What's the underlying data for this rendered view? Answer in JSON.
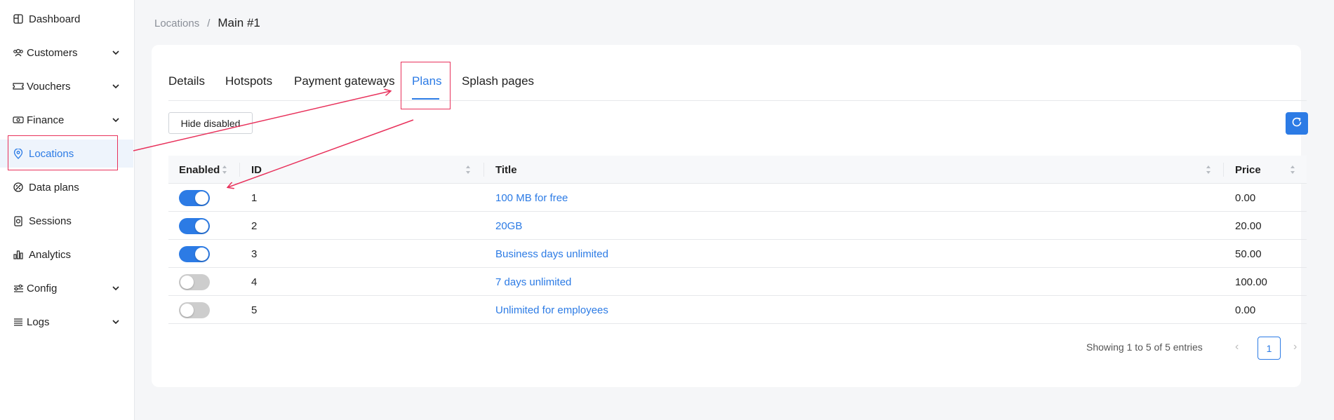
{
  "sidebar": {
    "items": [
      {
        "label": "Dashboard",
        "icon": "dashboard-icon"
      },
      {
        "label": "Customers",
        "icon": "customers-icon",
        "expandable": true
      },
      {
        "label": "Vouchers",
        "icon": "vouchers-icon",
        "expandable": true
      },
      {
        "label": "Finance",
        "icon": "finance-icon",
        "expandable": true
      },
      {
        "label": "Locations",
        "icon": "location-pin-icon",
        "active": true
      },
      {
        "label": "Data plans",
        "icon": "data-plans-icon"
      },
      {
        "label": "Sessions",
        "icon": "sessions-icon"
      },
      {
        "label": "Analytics",
        "icon": "analytics-icon"
      },
      {
        "label": "Config",
        "icon": "config-icon",
        "expandable": true
      },
      {
        "label": "Logs",
        "icon": "logs-icon",
        "expandable": true
      }
    ]
  },
  "breadcrumb": {
    "parent": "Locations",
    "separator": "/",
    "current": "Main #1"
  },
  "tabs": [
    {
      "label": "Details"
    },
    {
      "label": "Hotspots"
    },
    {
      "label": "Payment gateways"
    },
    {
      "label": "Plans",
      "active": true
    },
    {
      "label": "Splash pages"
    }
  ],
  "toolbar": {
    "hide_disabled_label": "Hide disabled",
    "refresh_icon": "refresh-icon"
  },
  "table": {
    "headers": {
      "enabled": "Enabled",
      "id": "ID",
      "title": "Title",
      "price": "Price"
    },
    "rows": [
      {
        "enabled": true,
        "id": "1",
        "title": "100 MB for free",
        "price": "0.00"
      },
      {
        "enabled": true,
        "id": "2",
        "title": "20GB",
        "price": "20.00"
      },
      {
        "enabled": true,
        "id": "3",
        "title": "Business days unlimited",
        "price": "50.00"
      },
      {
        "enabled": false,
        "id": "4",
        "title": "7 days unlimited",
        "price": "100.00"
      },
      {
        "enabled": false,
        "id": "5",
        "title": "Unlimited for employees",
        "price": "0.00"
      }
    ]
  },
  "footer": {
    "info": "Showing 1 to 5 of 5 entries",
    "prev": "‹",
    "page": "1",
    "next": "›"
  },
  "colors": {
    "accent": "#2c7be5",
    "annotation": "#e8315b"
  }
}
